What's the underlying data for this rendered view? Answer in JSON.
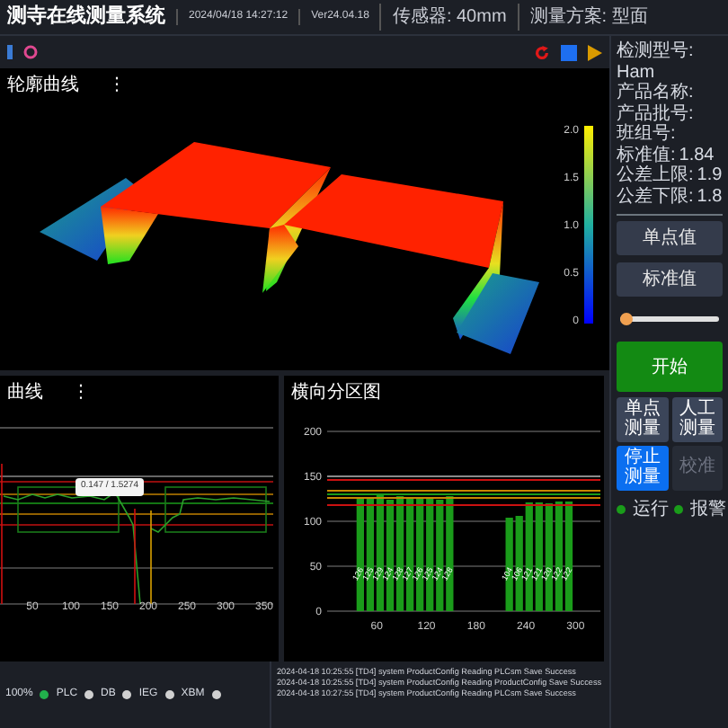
{
  "header": {
    "title": "测寺在线测量系统",
    "items": [
      "2024/04/18 14:27:12",
      "Ver24.04.18",
      "传感器: 40mm",
      "测量方案: 型面"
    ]
  },
  "surface_panel": {
    "title": "轮廓曲线",
    "menu": "⋮",
    "colorbar_ticks": [
      "2.0",
      "1.5",
      "1.0",
      "0.5",
      "0"
    ]
  },
  "info": [
    {
      "label": "检测型号:",
      "value": "Ham"
    },
    {
      "label": "产品名称:"
    },
    {
      "label": "产品批号:"
    },
    {
      "label": "班组号:"
    },
    {
      "label": "标准值:",
      "value": "1.84"
    },
    {
      "label": "公差上限:",
      "value": "1.9"
    },
    {
      "label": "公差下限:",
      "value": "1.8"
    }
  ],
  "info_buttons": [
    "单点值",
    "标准值"
  ],
  "line_panel": {
    "title": "曲线",
    "menu": "⋮",
    "tooltip": "0.147 / 1.5274",
    "xticks": [
      "50",
      "100",
      "150",
      "200",
      "250",
      "300",
      "350"
    ]
  },
  "bar_panel": {
    "chart_data": {
      "type": "bar",
      "title": "横向分区图",
      "x": [
        40,
        52,
        64,
        76,
        88,
        100,
        112,
        124,
        136,
        148,
        220,
        232,
        244,
        256,
        268,
        280,
        292
      ],
      "series": [
        {
          "color": "#1a9c1a",
          "values": [
            126,
            125,
            129,
            124,
            128,
            127,
            126,
            125,
            124,
            128,
            104,
            106,
            121,
            121,
            120,
            122,
            122
          ]
        }
      ],
      "xlim": [
        0,
        330
      ],
      "ylim": [
        0,
        200
      ],
      "xticks": [
        60,
        120,
        180,
        240,
        300
      ],
      "yticks": [
        0,
        50,
        100,
        150,
        200
      ],
      "data_labels": true,
      "ref_lines": [
        {
          "axis": "y",
          "value": 150,
          "color": "#8a8a8a"
        },
        {
          "axis": "y",
          "value": 146,
          "color": "#cc1111"
        },
        {
          "axis": "y",
          "value": 134,
          "color": "#c88a00"
        },
        {
          "axis": "y",
          "value": 130,
          "color": "#1a9c1a"
        },
        {
          "axis": "y",
          "value": 126,
          "color": "#c88a00"
        },
        {
          "axis": "y",
          "value": 118,
          "color": "#cc1111"
        }
      ]
    }
  },
  "status": [
    {
      "label": "100%",
      "color": "#22b14c"
    },
    {
      "label": "PLC",
      "color": "#d0d0d0"
    },
    {
      "label": "DB",
      "color": "#d0d0d0"
    },
    {
      "label": "IEG",
      "color": "#d0d0d0"
    },
    {
      "label": "XBM",
      "color": "#d0d0d0"
    }
  ],
  "log": [
    "2024-04-18 10:25:55 [TD4] system ProductConfig Reading PLCsm Save Success",
    "2024-04-18 10:25:55 [TD4] system ProductConfig Reading ProductConfig Save Success",
    "2024-04-18 10:27:55 [TD4] system ProductConfig Reading PLCsm Save Success"
  ],
  "controls": {
    "slider": {
      "level": 0.05
    },
    "start_button": "开始",
    "buttons": [
      {
        "label": "单点测量",
        "kind": "normal"
      },
      {
        "label": "人工测量",
        "kind": "normal"
      },
      {
        "label": "停止测量",
        "kind": "primary"
      },
      {
        "label": "校准",
        "kind": "disabled"
      }
    ],
    "indicators": [
      {
        "label": "运行",
        "color": "#1a9c1a"
      },
      {
        "label": "报警",
        "color": "#1a9c1a"
      }
    ]
  }
}
